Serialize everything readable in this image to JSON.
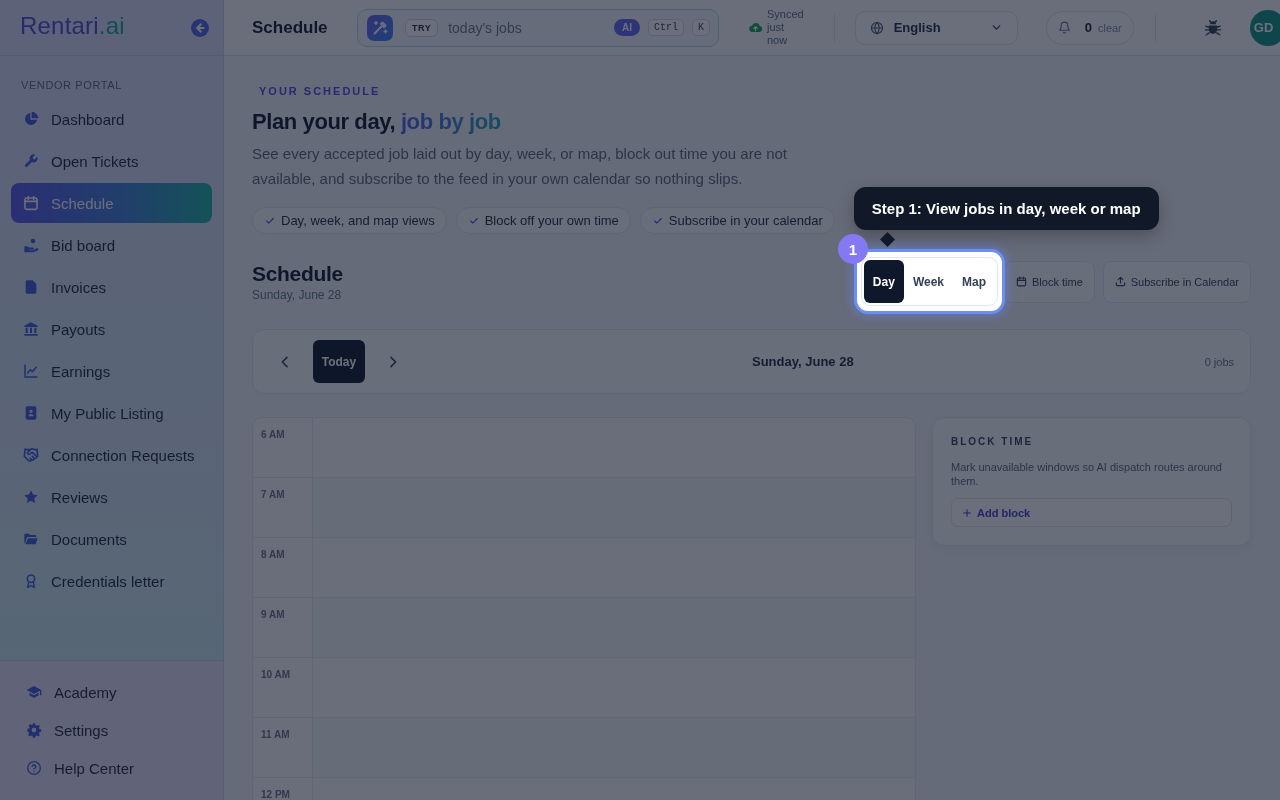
{
  "sidebar": {
    "logo": {
      "name": "Rentari",
      "suffix": ".ai"
    },
    "section_label": "VENDOR PORTAL",
    "items": [
      {
        "label": "Dashboard",
        "selected": false
      },
      {
        "label": "Open Tickets",
        "selected": false
      },
      {
        "label": "Schedule",
        "selected": true
      },
      {
        "label": "Bid board",
        "selected": false
      },
      {
        "label": "Invoices",
        "selected": false
      },
      {
        "label": "Payouts",
        "selected": false
      },
      {
        "label": "Earnings",
        "selected": false
      },
      {
        "label": "My Public Listing",
        "selected": false
      },
      {
        "label": "Connection Requests",
        "selected": false
      },
      {
        "label": "Reviews",
        "selected": false
      },
      {
        "label": "Documents",
        "selected": false
      },
      {
        "label": "Credentials letter",
        "selected": false
      }
    ],
    "footer_items": [
      {
        "label": "Academy"
      },
      {
        "label": "Settings"
      },
      {
        "label": "Help Center"
      }
    ]
  },
  "header": {
    "title": "Schedule",
    "search": {
      "tag": "TRY",
      "placeholder": "today's jobs",
      "ai_badge": "AI",
      "shortcut": [
        "Ctrl",
        "K"
      ]
    },
    "sync_status": "Synced just now",
    "language": "English",
    "notifications": {
      "count": "0",
      "action": "clear"
    },
    "avatar": "GD"
  },
  "intro": {
    "eyebrow": "YOUR SCHEDULE",
    "title": "Plan your day,",
    "title_accent": "job by job",
    "description": "See every accepted job laid out by day, week, or map, block out time you are not available, and subscribe to the feed in your own calendar so nothing slips.",
    "features": [
      "Day, week, and map views",
      "Block off your own time",
      "Subscribe in your calendar"
    ]
  },
  "schedule": {
    "title": "Schedule",
    "date": "Sunday, June 28",
    "views": [
      {
        "label": "Day",
        "selected": true
      },
      {
        "label": "Week",
        "selected": false
      },
      {
        "label": "Map",
        "selected": false
      }
    ],
    "actions": [
      "Block time",
      "Subscribe in Calendar"
    ],
    "navigator": {
      "today": "Today",
      "date": "Sunday, June 28",
      "job_count": "0 jobs"
    },
    "hours": [
      "6 AM",
      "7 AM",
      "8 AM",
      "9 AM",
      "10 AM",
      "11 AM",
      "12 PM"
    ],
    "block_panel": {
      "title": "BLOCK TIME",
      "description": "Mark unavailable windows so AI dispatch routes around them.",
      "button": "Add block"
    }
  },
  "tour": {
    "step": "1",
    "text": "Step 1: View jobs in day, week or map"
  }
}
